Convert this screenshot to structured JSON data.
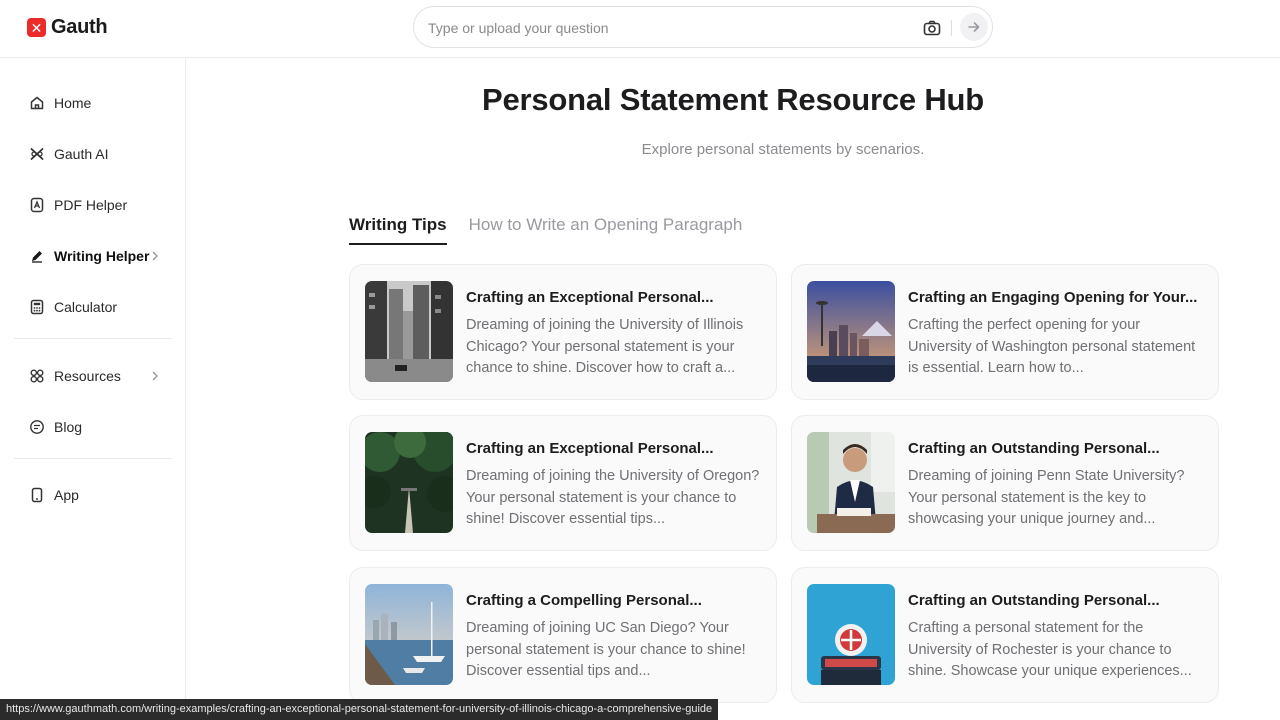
{
  "brand": {
    "name": "Gauth",
    "mark": "✕",
    "color": "#ec2b2b"
  },
  "search": {
    "placeholder": "Type or upload your question"
  },
  "sidebar": {
    "items": [
      {
        "label": "Home",
        "icon": "home-icon"
      },
      {
        "label": "Gauth AI",
        "icon": "gauth-ai-icon"
      },
      {
        "label": "PDF Helper",
        "icon": "pdf-icon"
      },
      {
        "label": "Writing Helper",
        "icon": "pen-icon",
        "active": true
      },
      {
        "label": "Calculator",
        "icon": "calculator-icon"
      },
      {
        "label": "Resources",
        "icon": "grid-icon"
      },
      {
        "label": "Blog",
        "icon": "blog-icon"
      },
      {
        "label": "App",
        "icon": "phone-icon"
      }
    ]
  },
  "main": {
    "title": "Personal Statement Resource Hub",
    "subtitle": "Explore personal statements by scenarios.",
    "tabs": [
      {
        "label": "Writing Tips",
        "active": true
      },
      {
        "label": "How to Write an Opening Paragraph",
        "active": false
      }
    ],
    "cards": [
      {
        "title": "Crafting an Exceptional Personal...",
        "desc": "Dreaming of joining the University of Illinois Chicago? Your personal statement is your chance to shine. Discover how to craft a...",
        "image": "city-street-photo"
      },
      {
        "title": "Crafting an Engaging Opening for Your...",
        "desc": "Crafting the perfect opening for your University of Washington personal statement is essential. Learn how to...",
        "image": "seattle-skyline-photo"
      },
      {
        "title": "Crafting an Exceptional Personal...",
        "desc": "Dreaming of joining the University of Oregon? Your personal statement is your chance to shine! Discover essential tips...",
        "image": "forest-path-photo"
      },
      {
        "title": "Crafting an Outstanding Personal...",
        "desc": "Dreaming of joining Penn State University? Your personal statement is the key to showcasing your unique journey and...",
        "image": "man-writing-photo"
      },
      {
        "title": "Crafting a Compelling Personal...",
        "desc": "Dreaming of joining UC San Diego? Your personal statement is your chance to shine! Discover essential tips and...",
        "image": "harbor-photo"
      },
      {
        "title": "Crafting an Outstanding Personal...",
        "desc": "Crafting a personal statement for the University of Rochester is your chance to shine. Showcase your unique experiences...",
        "image": "rochester-sign-photo"
      }
    ]
  },
  "status_url": "https://www.gauthmath.com/writing-examples/crafting-an-exceptional-personal-statement-for-university-of-illinois-chicago-a-comprehensive-guide"
}
